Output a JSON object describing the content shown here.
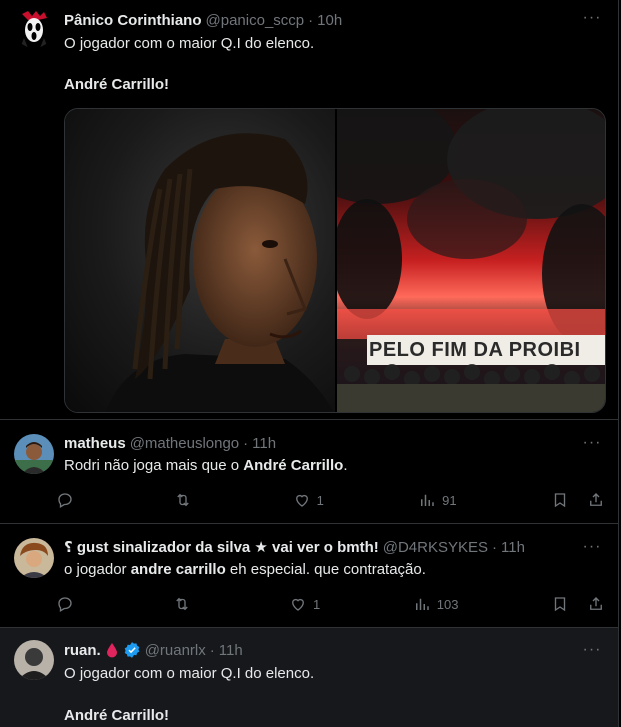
{
  "tweets": [
    {
      "name": "Pânico Corinthiano",
      "handle": "@panico_sccp",
      "time": "10h",
      "line1": "O jogador com o maior Q.I do elenco.",
      "line2": "André Carrillo!",
      "banner_text": "PELO FIM DA PROIBI"
    },
    {
      "name": "matheus",
      "handle": "@matheuslongo",
      "time": "11h",
      "text_before": "Rodri não joga mais que o ",
      "text_bold": "André Carrillo",
      "text_after": ".",
      "replies": "",
      "retweets": "",
      "likes": "1",
      "views": "91"
    },
    {
      "name": "⸮ gust sinalizador da silva ★ vai ver o bmth!",
      "handle": "@D4RKSYKES",
      "time": "11h",
      "text_before": "o jogador ",
      "text_bold": "andre carrillo",
      "text_after": " eh especial. que contratação.",
      "replies": "",
      "retweets": "",
      "likes": "1",
      "views": "103"
    },
    {
      "name": "ruan.",
      "handle": "@ruanrlx",
      "time": "11h",
      "line1": "O jogador com o maior Q.I do elenco.",
      "line2": "André Carrillo!"
    }
  ],
  "common": {
    "dot": "·",
    "more": "···"
  },
  "colors": {
    "background": "#000000",
    "highlight_background": "#16181c",
    "border": "#2f3336",
    "text": "#e7e9ea",
    "secondary": "#71767b",
    "verified": "#1d9bf0",
    "drop": "#e0245e"
  },
  "icons": [
    "reply-icon",
    "retweet-icon",
    "like-icon",
    "views-icon",
    "bookmark-icon",
    "share-icon",
    "verified-icon",
    "blood-drop-icon"
  ]
}
